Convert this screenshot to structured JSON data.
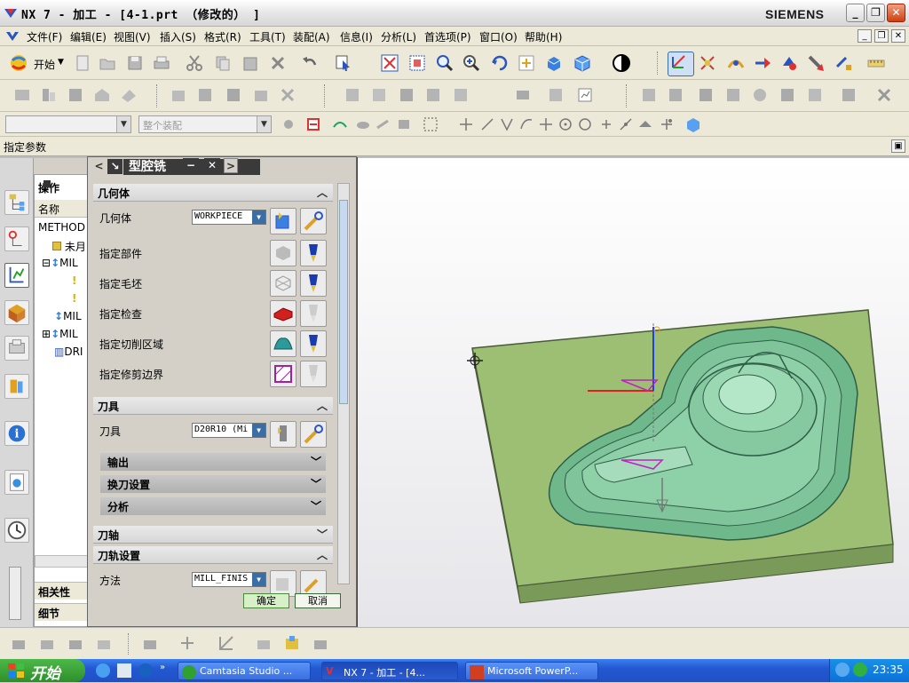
{
  "window": {
    "title": "NX 7 - 加工 - [4-1.prt （修改的） ]",
    "brand": "SIEMENS"
  },
  "menu": [
    "文件(F)",
    "编辑(E)",
    "视图(V)",
    "插入(S)",
    "格式(R)",
    "工具(T)",
    "装配(A)",
    "信息(I)",
    "分析(L)",
    "首选项(P)",
    "窗口(O)",
    "帮助(H)"
  ],
  "toolbar": {
    "start_label": "开始",
    "filter_placeholder": "",
    "assembly_scope": "整个装配"
  },
  "cue": {
    "text": "指定参数"
  },
  "navigator": {
    "title": "操作",
    "column": "名称",
    "rows": [
      "METHOD",
      "未月",
      "MIL",
      "MIL",
      "MIL",
      "DRI"
    ],
    "section1": "相关性",
    "section2": "细节"
  },
  "dialog": {
    "title": "型腔铣",
    "geometry": {
      "header": "几何体",
      "geometry_label": "几何体",
      "geometry_value": "WORKPIECE",
      "items": [
        "指定部件",
        "指定毛坯",
        "指定检查",
        "指定切削区域",
        "指定修剪边界"
      ]
    },
    "tool": {
      "header": "刀具",
      "tool_label": "刀具",
      "tool_value": "D20R10 (Mi",
      "subs": [
        "输出",
        "换刀设置",
        "分析"
      ]
    },
    "axis_header": "刀轴",
    "path": {
      "header": "刀轨设置",
      "method_label": "方法",
      "method_value": "MILL_FINIS"
    },
    "ok": "确定",
    "cancel": "取消"
  },
  "taskbar": {
    "start": "开始",
    "tasks": [
      "Camtasia Studio ...",
      "NX 7 - 加工 - [4...",
      "Microsoft PowerP..."
    ],
    "time": "23:35"
  },
  "colors": {
    "part_green": "#7fc49a",
    "stock_green": "#9cbf74",
    "accent": "#3a6ea5"
  }
}
